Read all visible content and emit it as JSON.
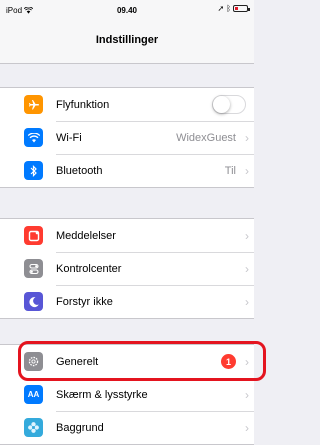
{
  "status": {
    "device": "iPod",
    "time": "09.40",
    "colors": {
      "battery_fill": "#e01b2b"
    }
  },
  "nav": {
    "title": "Indstillinger"
  },
  "groups": [
    {
      "items": [
        {
          "label": "Flyfunktion",
          "icon": "airplane-icon",
          "icon_color": "#ff9500",
          "accessory": "toggle",
          "toggle_on": false
        },
        {
          "label": "Wi-Fi",
          "icon": "wifi-icon",
          "icon_color": "#007aff",
          "value": "WidexGuest"
        },
        {
          "label": "Bluetooth",
          "icon": "bluetooth-icon",
          "icon_color": "#007aff",
          "value": "Til"
        }
      ]
    },
    {
      "items": [
        {
          "label": "Meddelelser",
          "icon": "notifications-icon",
          "icon_color": "#ff3b30"
        },
        {
          "label": "Kontrolcenter",
          "icon": "control-center-icon",
          "icon_color": "#8e8e93"
        },
        {
          "label": "Forstyr ikke",
          "icon": "moon-icon",
          "icon_color": "#5856d6"
        }
      ]
    },
    {
      "items": [
        {
          "label": "Generelt",
          "icon": "gear-icon",
          "icon_color": "#8e8e93",
          "badge": "1",
          "highlighted": true
        },
        {
          "label": "Skærm & lysstyrke",
          "icon": "display-brightness-icon",
          "icon_color": "#007aff",
          "icon_text": "AA"
        },
        {
          "label": "Baggrund",
          "icon": "wallpaper-icon",
          "icon_color": "#34aadc"
        }
      ]
    }
  ],
  "highlight_color": "#e4141f"
}
